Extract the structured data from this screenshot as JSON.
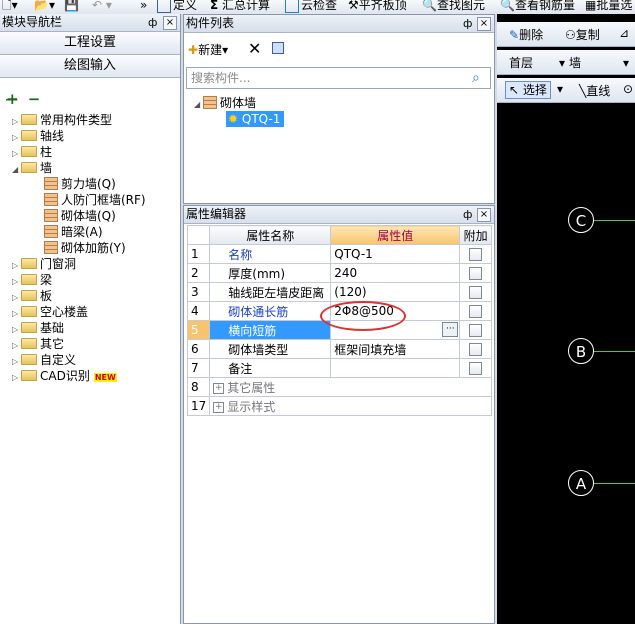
{
  "toolbar": {
    "define": "定义",
    "sum_calc": "汇总计算",
    "cloud_check": "云检查",
    "flat_top": "平齐板顶",
    "find_element": "查找图元",
    "view_rebar": "查看钢筋量",
    "batch": "批量选"
  },
  "left_panel": {
    "title": "模块导航栏",
    "pin": "ф",
    "close": "×",
    "btn_project": "工程设置",
    "btn_drawing": "绘图输入",
    "tree": [
      {
        "label": "常用构件类型",
        "expanded": false
      },
      {
        "label": "轴线",
        "expanded": false
      },
      {
        "label": "柱",
        "expanded": false
      },
      {
        "label": "墙",
        "expanded": true
      },
      {
        "label": "门窗洞",
        "expanded": false
      },
      {
        "label": "梁",
        "expanded": false
      },
      {
        "label": "板",
        "expanded": false
      },
      {
        "label": "空心楼盖",
        "expanded": false
      },
      {
        "label": "基础",
        "expanded": false
      },
      {
        "label": "其它",
        "expanded": false
      },
      {
        "label": "自定义",
        "expanded": false
      },
      {
        "label": "CAD识别",
        "expanded": false
      }
    ],
    "wall_children": [
      "剪力墙(Q)",
      "人防门框墙(RF)",
      "砌体墙(Q)",
      "暗梁(A)",
      "砌体加筋(Y)"
    ],
    "new_badge": "NEW"
  },
  "component_list": {
    "title": "构件列表",
    "new_label": "新建",
    "search_placeholder": "搜索构件...",
    "root": "砌体墙",
    "item": "QTQ-1"
  },
  "property_editor": {
    "title": "属性编辑器",
    "col_name": "属性名称",
    "col_value": "属性值",
    "col_extra": "附加",
    "rows": [
      {
        "num": "1",
        "name": "名称",
        "value": "QTQ-1"
      },
      {
        "num": "2",
        "name": "厚度(mm)",
        "value": "240"
      },
      {
        "num": "3",
        "name": "轴线距左墙皮距离",
        "value": "(120)"
      },
      {
        "num": "4",
        "name": "砌体通长筋",
        "value": "2Φ8@500"
      },
      {
        "num": "5",
        "name": "横向短筋",
        "value": ""
      },
      {
        "num": "6",
        "name": "砌体墙类型",
        "value": "框架间填充墙"
      },
      {
        "num": "7",
        "name": "备注",
        "value": ""
      },
      {
        "num": "8",
        "name": "其它属性",
        "value": ""
      },
      {
        "num": "17",
        "name": "显示样式",
        "value": ""
      }
    ],
    "ellipsis": "···"
  },
  "canvas": {
    "delete": "删除",
    "copy": "复制",
    "floor": "首层",
    "type": "墙",
    "select": "选择",
    "line": "直线",
    "axes": [
      "C",
      "B",
      "A"
    ]
  },
  "colors": {
    "accent": "#f7c46d",
    "selection": "#3399ff",
    "annotation": "#e03030",
    "axis_line": "#4fc24f"
  }
}
